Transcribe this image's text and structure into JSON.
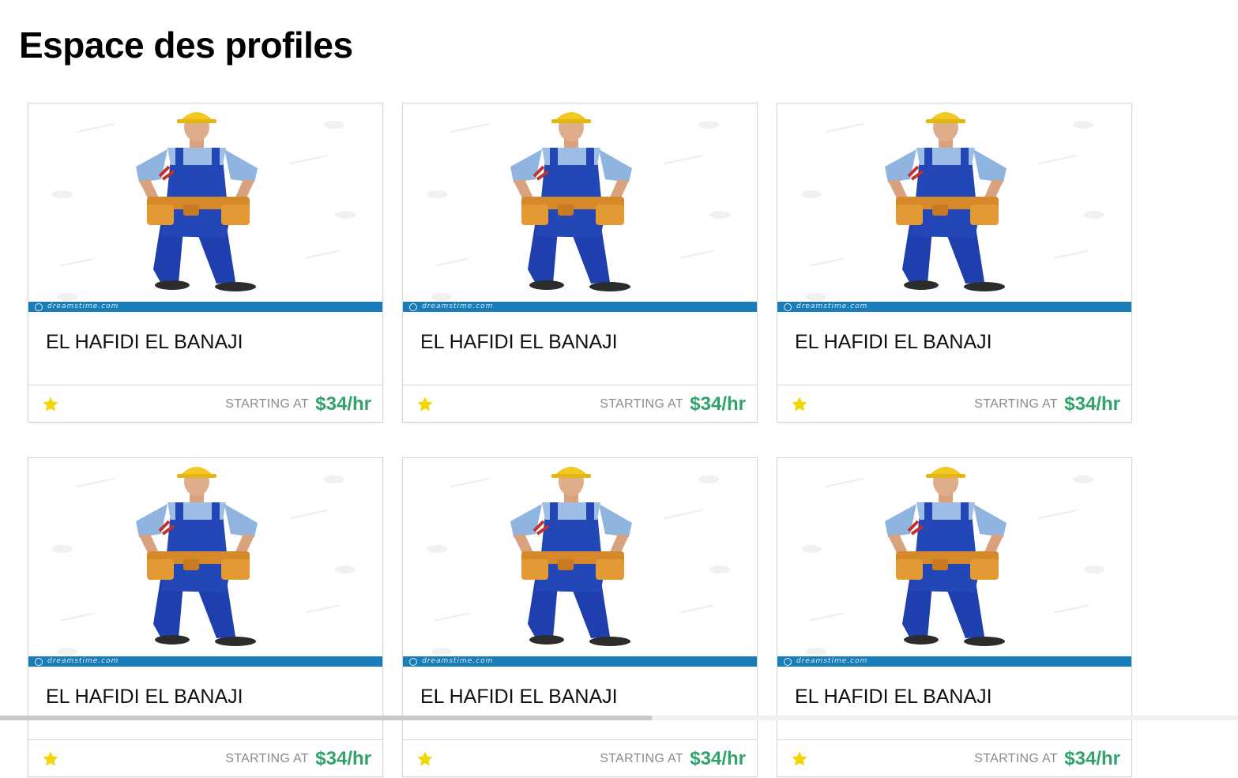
{
  "page": {
    "title": "Espace des profiles"
  },
  "profiles": [
    {
      "name": "EL HAFIDI EL BANAJI",
      "starting_label": "STARTING AT",
      "price": "$34/hr",
      "rating_icon": "star-icon",
      "image": "worker-photo",
      "watermark": "dreamstime.com"
    },
    {
      "name": "EL HAFIDI EL BANAJI",
      "starting_label": "STARTING AT",
      "price": "$34/hr",
      "rating_icon": "star-icon",
      "image": "worker-photo",
      "watermark": "dreamstime.com"
    },
    {
      "name": "EL HAFIDI EL BANAJI",
      "starting_label": "STARTING AT",
      "price": "$34/hr",
      "rating_icon": "star-icon",
      "image": "worker-photo",
      "watermark": "dreamstime.com"
    },
    {
      "name": "EL HAFIDI EL BANAJI",
      "starting_label": "STARTING AT",
      "price": "$34/hr",
      "rating_icon": "star-icon",
      "image": "worker-photo",
      "watermark": "dreamstime.com"
    },
    {
      "name": "EL HAFIDI EL BANAJI",
      "starting_label": "STARTING AT",
      "price": "$34/hr",
      "rating_icon": "star-icon",
      "image": "worker-photo",
      "watermark": "dreamstime.com"
    },
    {
      "name": "EL HAFIDI EL BANAJI",
      "starting_label": "STARTING AT",
      "price": "$34/hr",
      "rating_icon": "star-icon",
      "image": "worker-photo",
      "watermark": "dreamstime.com"
    }
  ],
  "colors": {
    "price": "#2fa36b",
    "star": "#f2d600",
    "watermark_bar": "#1b7db8",
    "card_border": "#d6d6d6"
  }
}
